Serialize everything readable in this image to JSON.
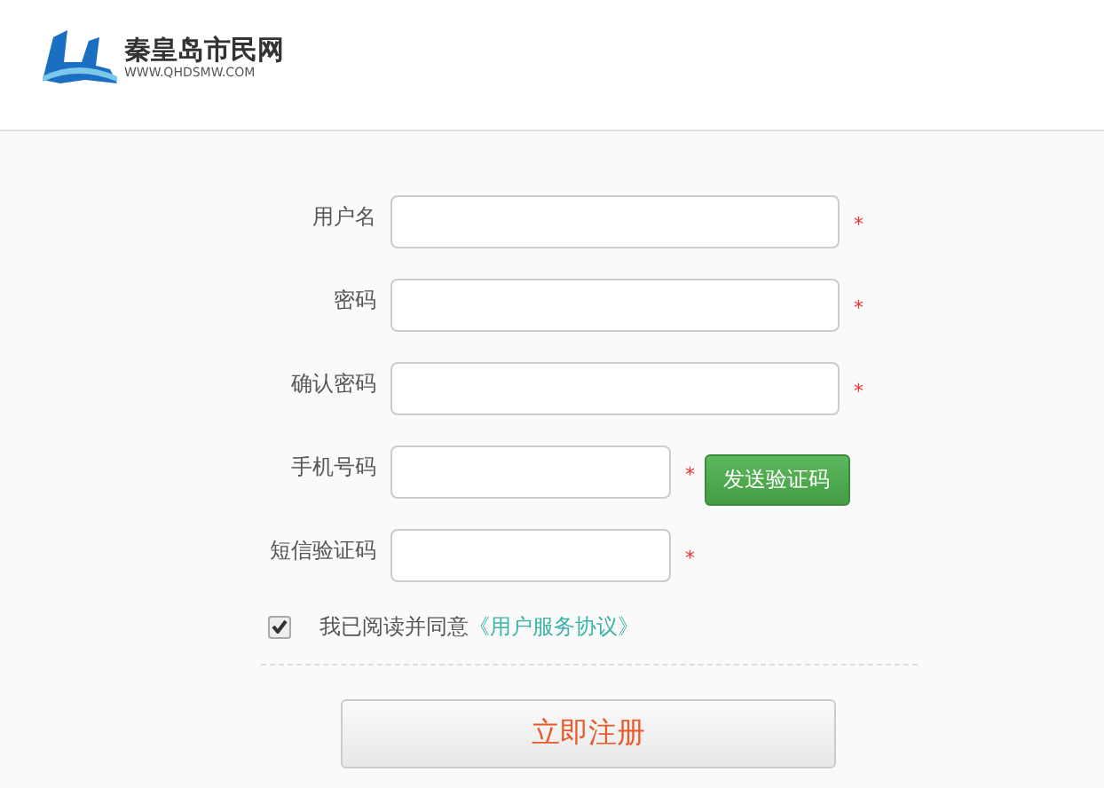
{
  "header": {
    "logo_title": "秦皇岛市民网",
    "logo_subtitle": "WWW.QHDSMW.COM"
  },
  "fields": [
    {
      "label": "用户名",
      "kind": "wide",
      "required": true,
      "mark": "*"
    },
    {
      "label": "密码",
      "kind": "wide",
      "required": true,
      "mark": "*"
    },
    {
      "label": "确认密码",
      "kind": "wide",
      "required": true,
      "mark": "*"
    },
    {
      "label": "手机号码",
      "kind": "short",
      "required": true,
      "mark": "*",
      "button": "发送验证码"
    },
    {
      "label": "短信验证码",
      "kind": "short",
      "required": true,
      "mark": "*"
    }
  ],
  "agreement": {
    "checked": true,
    "text": "我已阅读并同意",
    "link": "《用户服务协议》"
  },
  "submit": "立即注册"
}
